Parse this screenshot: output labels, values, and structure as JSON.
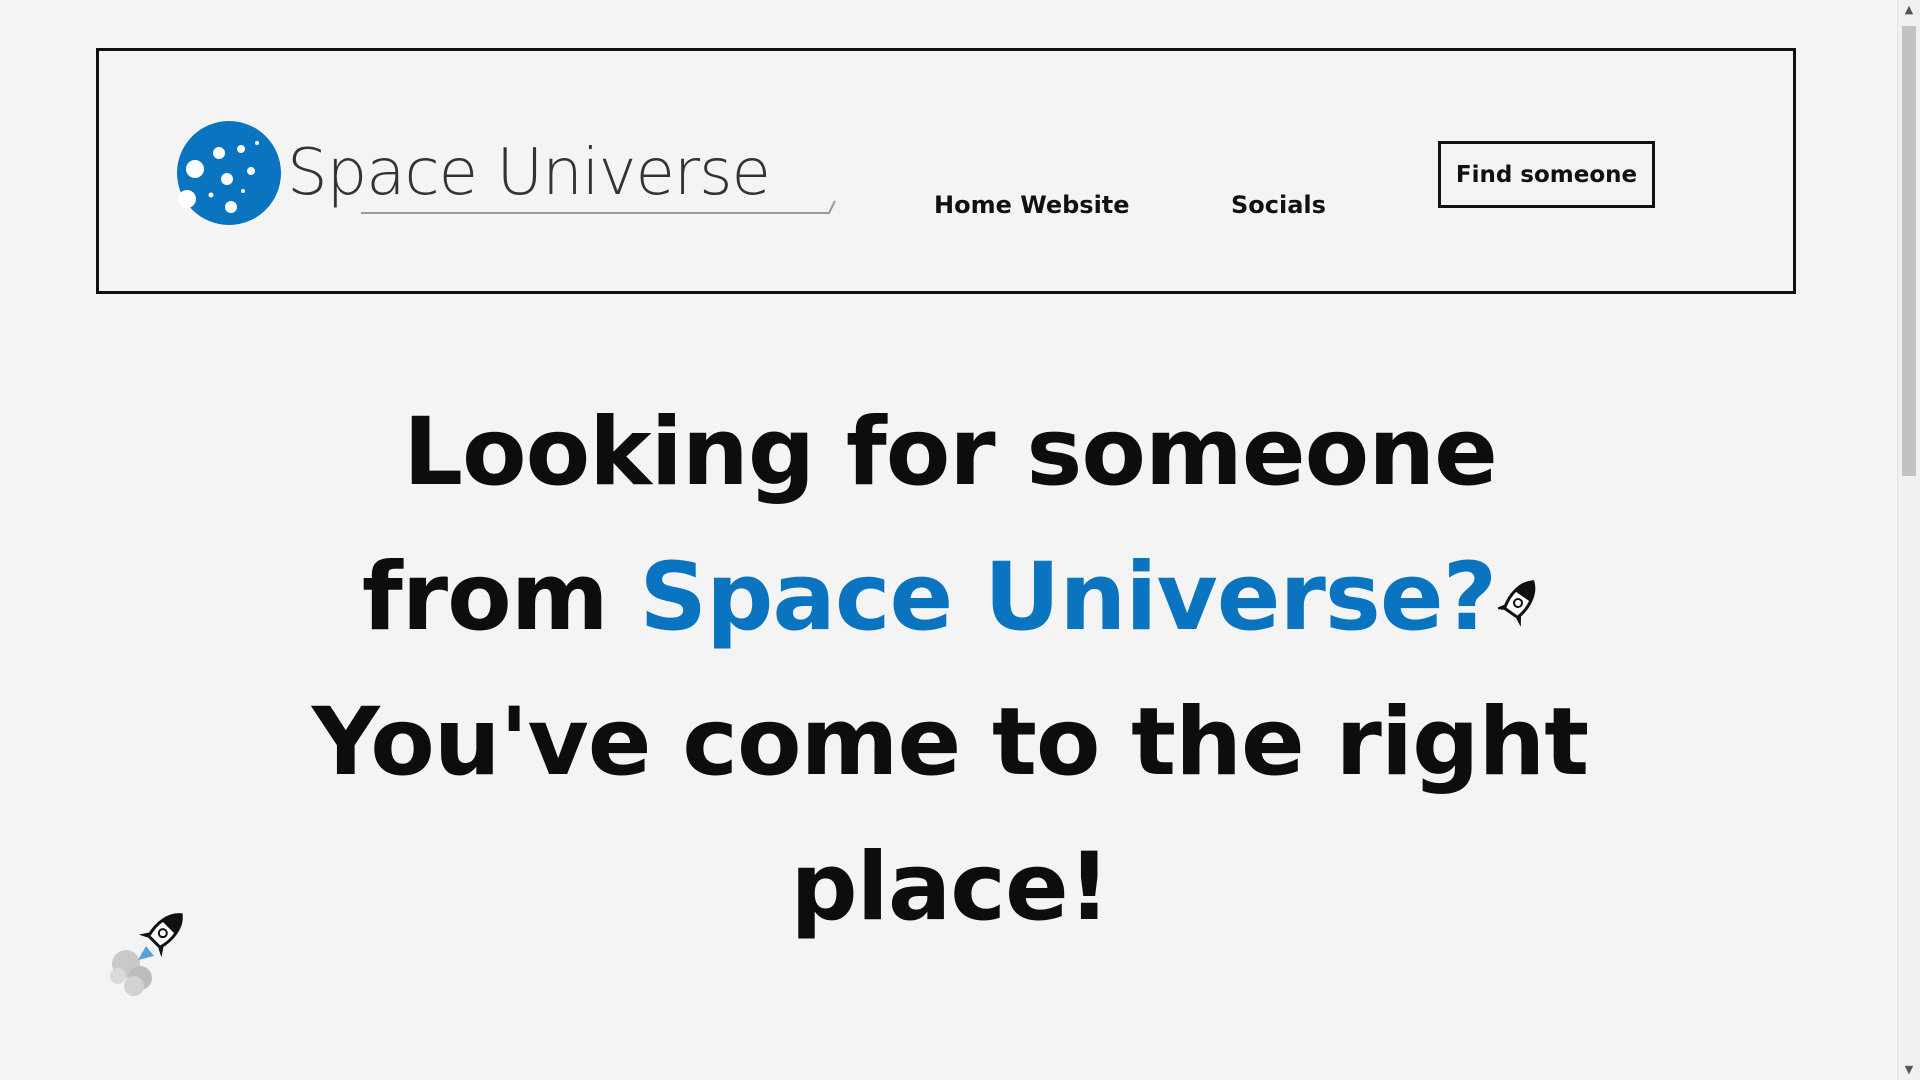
{
  "brand": {
    "name": "Space Universe",
    "logo_color": "#0a74c0"
  },
  "nav": {
    "home_label": "Home Website",
    "socials_label": "Socials",
    "cta_label": "Find someone"
  },
  "hero": {
    "line1": "Looking for someone",
    "line2_prefix": "from ",
    "line2_accent": "Space Universe?",
    "line3": "You've come to the right",
    "line4": "place!",
    "accent_color": "#0a74c0"
  },
  "icons": {
    "inline_rocket": "rocket-icon",
    "corner_rocket": "rocket-launch-icon"
  },
  "scrollbar": {
    "up_arrow": "▲",
    "down_arrow": "▼"
  }
}
